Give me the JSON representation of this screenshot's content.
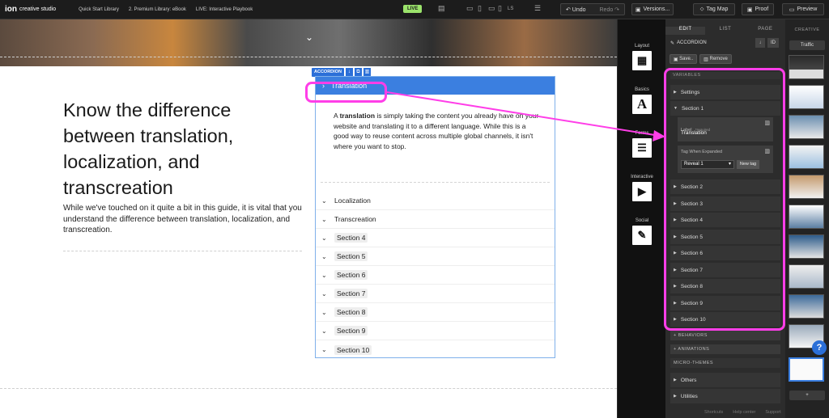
{
  "topbar": {
    "logo_mark": "ion",
    "logo_text": "creative studio",
    "crumbs": [
      "Quick Start Library",
      "2. Premium Library: eBook",
      "LIVE: Interactive Playbook"
    ],
    "live_badge": "LIVE",
    "device_label": "LS",
    "undo_label": "Undo",
    "redo_label": "Redo",
    "versions_label": "Versions...",
    "tagmap_label": "Tag Map",
    "proof_label": "Proof",
    "preview_label": "Preview"
  },
  "content": {
    "heading": "Know the difference between translation, localization, and transcreation",
    "paragraph": "While we've touched on it quite a bit in this guide, it is vital that you understand the difference between translation, localization, and transcreation."
  },
  "accordion": {
    "tag_label": "ACCORDION",
    "expanded_title": "Translation",
    "body_bold": "translation",
    "body_pre": "A ",
    "body_post": " is simply taking the content you already have on your website and translating it to a different language. While this is a good way to reuse content across multiple global channels, it isn't where you want to stop.",
    "items": [
      "Localization",
      "Transcreation",
      "Section 4",
      "Section 5",
      "Section 6",
      "Section 7",
      "Section 8",
      "Section 9",
      "Section 10"
    ]
  },
  "rail": {
    "items": [
      {
        "label": "Layout",
        "icon": "layout-icon"
      },
      {
        "label": "Basics",
        "icon": "text-icon"
      },
      {
        "label": "Forms",
        "icon": "form-icon"
      },
      {
        "label": "Interactive",
        "icon": "play-icon"
      },
      {
        "label": "Social",
        "icon": "chat-icon"
      }
    ]
  },
  "panel": {
    "tabs": [
      "EDIT",
      "LIST",
      "PAGE"
    ],
    "header": "ACCORDION",
    "id_label": "ID",
    "save_label": "Save..",
    "remove_label": "Remove",
    "variables_label": "VARIABLES",
    "settings_label": "Settings",
    "section1_label": "Section 1",
    "label_key": "Label",
    "required_note": "*required",
    "label_value": "Translation",
    "tag_key": "Tag When Expanded",
    "tag_value": "Reveal 1",
    "new_tag_label": "New tag",
    "sections": [
      "Section 2",
      "Section 3",
      "Section 4",
      "Section 5",
      "Section 6",
      "Section 7",
      "Section 8",
      "Section 9",
      "Section 10"
    ],
    "behaviors_label": "+ BEHAVIORS",
    "animations_label": "+ ANIMATIONS",
    "microthemes_label": "MICRO-THEMES",
    "others_label": "Others",
    "utilities_label": "Utilities"
  },
  "thumbs": {
    "tab_label": "CREATIVE",
    "traffic_label": "Traffic",
    "add_label": "+"
  },
  "footer": {
    "shortcuts": "Shortcuts",
    "help_center": "Help center",
    "support": "Support"
  },
  "colors": {
    "annotation": "#ff3ee8",
    "accent": "#2b6fd8",
    "live": "#9be36b"
  }
}
